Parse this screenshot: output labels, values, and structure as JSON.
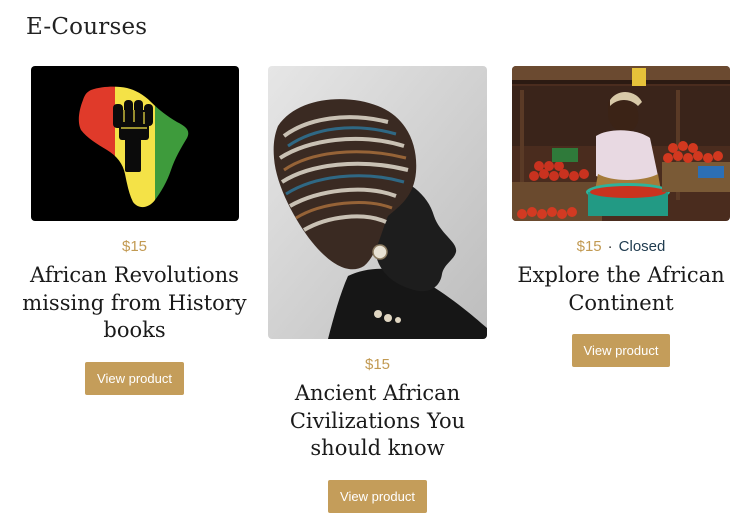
{
  "section": {
    "title": "E-Courses"
  },
  "products": [
    {
      "price": "$15",
      "status": "",
      "title": "African Revolutions missing from History books",
      "button": "View product",
      "image": "africa-fist-icon"
    },
    {
      "price": "$15",
      "status": "",
      "title": "Ancient African Civilizations You should know",
      "button": "View product",
      "image": "woman-headwrap-photo"
    },
    {
      "price": "$15",
      "status": "Closed",
      "title": "Explore the African Continent",
      "button": "View product",
      "image": "market-vendor-photo"
    }
  ],
  "colors": {
    "accent": "#c49d5a",
    "price": "#c29a52",
    "status": "#1e3a4e"
  }
}
